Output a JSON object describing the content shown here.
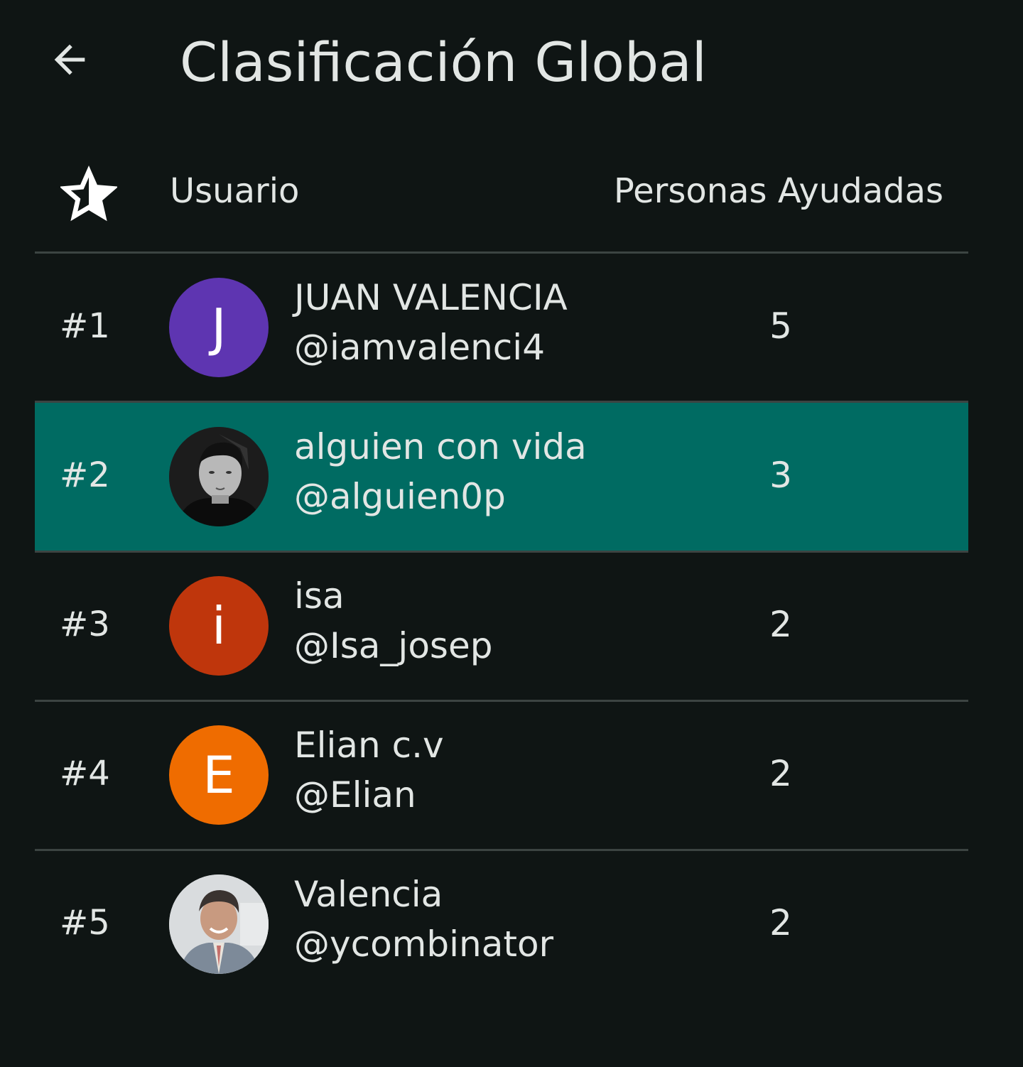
{
  "header": {
    "title": "Clasificación Global"
  },
  "table": {
    "columns": {
      "rank_icon": "star-icon",
      "user": "Usuario",
      "helped": "Personas Ayudadas"
    },
    "rows": [
      {
        "rank": "#1",
        "name": "JUAN VALENCIA",
        "handle": "@iamvalenci4",
        "count": "5",
        "avatar_letter": "J",
        "avatar_color": "#5e35b1",
        "highlighted": false
      },
      {
        "rank": "#2",
        "name": "alguien con vida",
        "handle": "@alguien0p",
        "count": "3",
        "avatar_letter": "",
        "avatar_color": "#2a2a2a",
        "highlighted": true
      },
      {
        "rank": "#3",
        "name": "isa",
        "handle": "@Isa_josep",
        "count": "2",
        "avatar_letter": "i",
        "avatar_color": "#bf360c",
        "highlighted": false
      },
      {
        "rank": "#4",
        "name": "Elian c.v",
        "handle": "@Elian",
        "count": "2",
        "avatar_letter": "E",
        "avatar_color": "#ef6c00",
        "highlighted": false
      },
      {
        "rank": "#5",
        "name": "Valencia",
        "handle": "@ycombinator",
        "count": "2",
        "avatar_letter": "",
        "avatar_color": "#c9cdd0",
        "highlighted": false
      }
    ]
  },
  "colors": {
    "background": "#0f1514",
    "highlight": "#006b62",
    "divider": "#3c4442",
    "text": "#e2e6e4"
  }
}
